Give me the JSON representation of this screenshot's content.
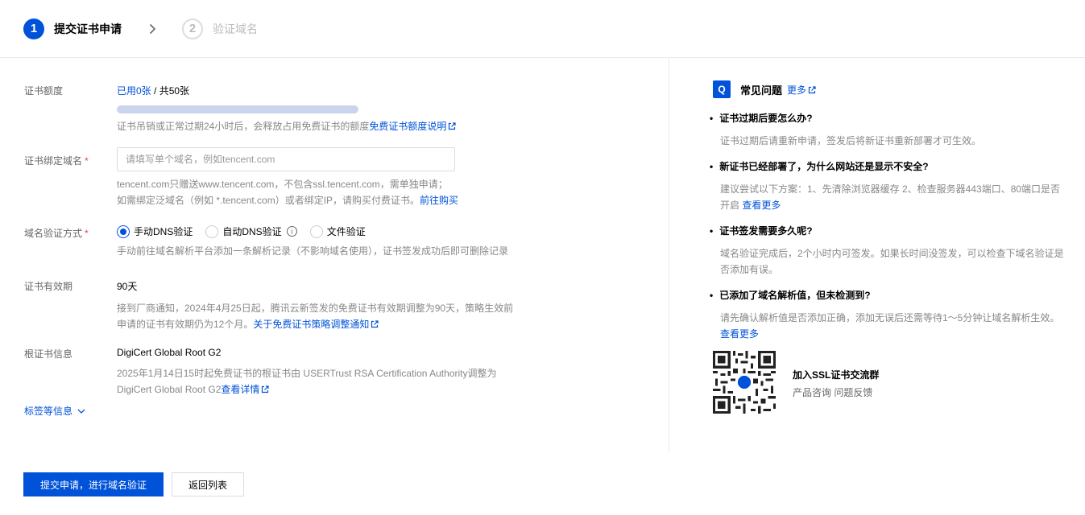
{
  "steps": [
    {
      "num": "1",
      "label": "提交证书申请"
    },
    {
      "num": "2",
      "label": "验证域名"
    }
  ],
  "form": {
    "quota": {
      "label": "证书额度",
      "used_text": "已用0张",
      "total_text": " / 共50张",
      "usage_fraction": 0.0,
      "help_text": "证书吊销或正常过期24小时后，会释放占用免费证书的额度",
      "help_link": "免费证书额度说明"
    },
    "domain": {
      "label": "证书绑定域名",
      "required": "*",
      "placeholder": "请填写单个域名，例如tencent.com",
      "value": "",
      "help_line1": "tencent.com只赠送www.tencent.com，不包含ssl.tencent.com，需单独申请；",
      "help_line2": "如需绑定泛域名（例如 *.tencent.com）或者绑定IP，请购买付费证书。",
      "help_link": "前往购买"
    },
    "verify": {
      "label": "域名验证方式",
      "required": "*",
      "options": [
        "手动DNS验证",
        "自动DNS验证",
        "文件验证"
      ],
      "selected": "手动DNS验证",
      "help_text": "手动前往域名解析平台添加一条解析记录（不影响域名使用），证书签发成功后即可删除记录"
    },
    "validity": {
      "label": "证书有效期",
      "value": "90天",
      "help_line1": "接到厂商通知，2024年4月25日起，腾讯云新签发的免费证书有效期调整为90天，策略生效前",
      "help_line2": "申请的证书有效期仍为12个月。",
      "help_link": "关于免费证书策略调整通知"
    },
    "root": {
      "label": "根证书信息",
      "value": "DigiCert Global Root G2",
      "help_line1": "2025年1月14日15时起免费证书的根证书由 USERTrust RSA Certification Authority调整为",
      "help_line2": "DigiCert Global Root G2",
      "help_link": "查看详情"
    },
    "tags_toggle": "标签等信息"
  },
  "buttons": {
    "submit": "提交申请，进行域名验证",
    "back": "返回列表"
  },
  "faq": {
    "icon_text": "Q",
    "title": "常见问题",
    "more": "更多",
    "items": [
      {
        "q": "证书过期后要怎么办?",
        "a": "证书过期后请重新申请，签发后将新证书重新部署才可生效。",
        "link": ""
      },
      {
        "q": "新证书已经部署了，为什么网站还是显示不安全?",
        "a": "建议尝试以下方案：1、先清除浏览器缓存 2、检查服务器443端口、80端口是否开启 ",
        "link": "查看更多"
      },
      {
        "q": "证书签发需要多久呢?",
        "a": "域名验证完成后，2个小时内可签发。如果长时间没签发，可以检查下域名验证是否添加有误。",
        "link": ""
      },
      {
        "q": "已添加了域名解析值，但未检测到?",
        "a": "请先确认解析值是否添加正确，添加无误后还需等待1～5分钟让域名解析生效。",
        "link": "查看更多"
      }
    ],
    "group_title": "加入SSL证书交流群",
    "group_sub": "产品咨询 问题反馈"
  },
  "colors": {
    "primary": "#0052d9",
    "required": "#e54545",
    "progress_track": "#c9d5ec"
  }
}
